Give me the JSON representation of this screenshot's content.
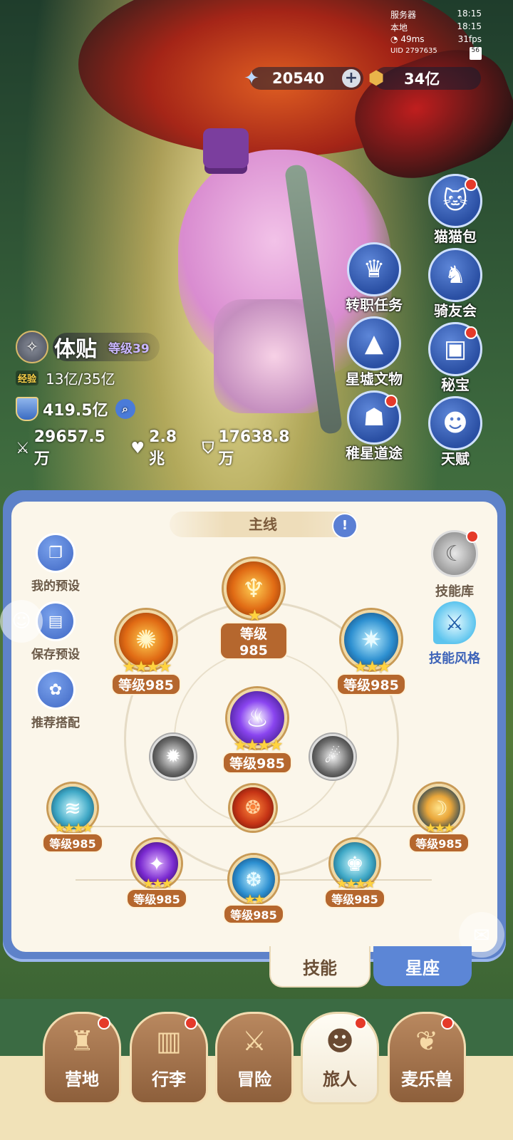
{
  "status": {
    "server_label": "服务器",
    "server_time": "18:15",
    "local_label": "本地",
    "local_time": "18:15",
    "ping": "49ms",
    "fps": "31fps",
    "uid": "UID 2797635",
    "battery": "56"
  },
  "currency": {
    "stars": "20540",
    "gold": "34亿"
  },
  "side_buttons": {
    "cat_bag": "猫猫包",
    "job_task": "转职任务",
    "rider_club": "骑友会",
    "relics": "星墟文物",
    "treasure": "秘宝",
    "star_path": "稚星道途",
    "talent": "天赋"
  },
  "player": {
    "name": "体贴",
    "level": "等级39",
    "exp_tag": "经验",
    "exp": "13亿/35亿",
    "power": "419.5亿",
    "attack": "29657.5万",
    "hp": "2.8兆",
    "defense": "17638.8万"
  },
  "panel": {
    "tab_title": "主线",
    "my_preset": "我的预设",
    "save_preset": "保存预设",
    "recommend": "推荐搭配",
    "skill_library": "技能库",
    "skill_style": "技能风格"
  },
  "skills": {
    "top": "等级985",
    "left_upper": "等级985",
    "right_upper": "等级985",
    "center": "等级985",
    "far_left": "等级985",
    "far_right": "等级985",
    "bottom_left": "等级985",
    "bottom_center": "等级985",
    "bottom_right": "等级985"
  },
  "bottom_tabs": {
    "skill": "技能",
    "constellation": "星座"
  },
  "nav": {
    "camp": "营地",
    "luggage": "行李",
    "adventure": "冒险",
    "traveler": "旅人",
    "beast": "麦乐兽"
  },
  "colors": {
    "accent_blue": "#5e82c9",
    "level_badge": "#b5672e",
    "red_dot": "#e53a2a",
    "panel_bg": "#fbf6ea"
  }
}
